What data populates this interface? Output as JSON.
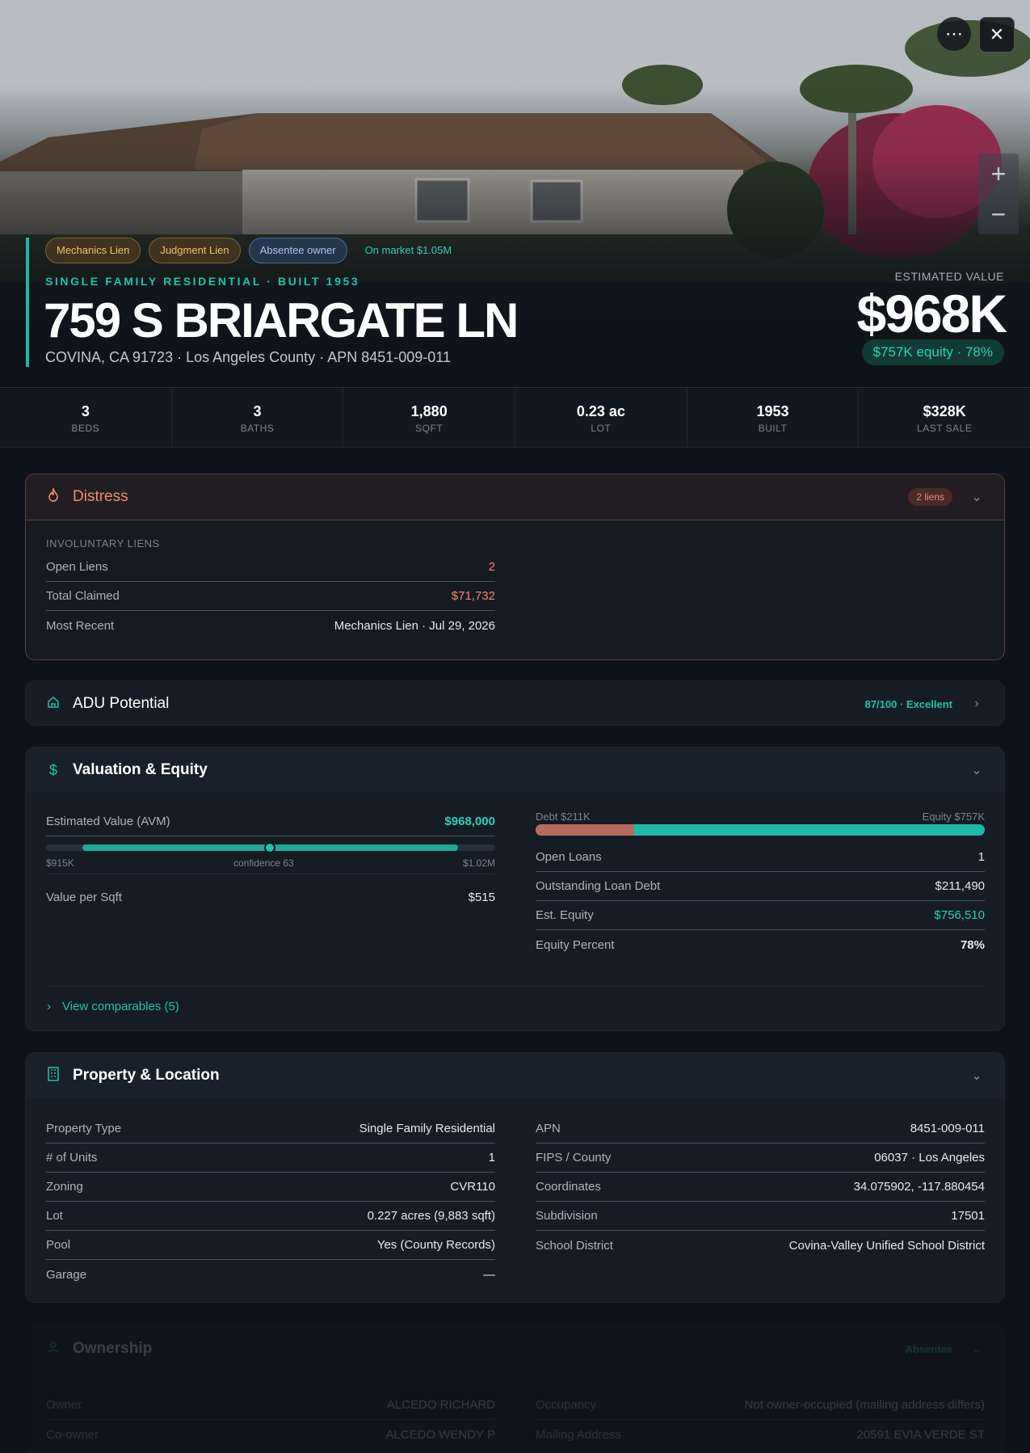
{
  "hero": {
    "tags": [
      "Mechanics Lien",
      "Judgment Lien",
      "Absentee owner",
      "On market $1.05M"
    ],
    "subtitle": "SINGLE FAMILY RESIDENTIAL · BUILT 1953",
    "address": "759 S BRIARGATE LN",
    "location": "COVINA, CA 91723 · Los Angeles County · APN 8451-009-011",
    "estimated_label": "ESTIMATED VALUE",
    "estimated_value": "$968K",
    "equity_badge": "$757K equity · 78%",
    "more_icon": "⋯",
    "close_icon": "✕",
    "zoom_in": "+",
    "zoom_out": "−"
  },
  "stats": [
    {
      "value": "3",
      "label": "BEDS"
    },
    {
      "value": "3",
      "label": "BATHS"
    },
    {
      "value": "1,880",
      "label": "SQFT"
    },
    {
      "value": "0.23 ac",
      "label": "LOT"
    },
    {
      "value": "1953",
      "label": "BUILT"
    },
    {
      "value": "$328K",
      "label": "LAST SALE"
    }
  ],
  "distress": {
    "title": "Distress",
    "badge": "2 liens",
    "section": "INVOLUNTARY LIENS",
    "rows": [
      {
        "k": "Open Liens",
        "v": "2"
      },
      {
        "k": "Total Claimed",
        "v": "$71,732"
      },
      {
        "k": "Most Recent",
        "v": "Mechanics Lien · Jul 29, 2026"
      }
    ]
  },
  "adu": {
    "title": "ADU Potential",
    "score": "87/100 · Excellent"
  },
  "valuation": {
    "title": "Valuation & Equity",
    "avm_label": "Estimated Value (AVM)",
    "avm_value": "$968,000",
    "range_low": "$915K",
    "confidence": "confidence 63",
    "range_high": "$1.02M",
    "vps_label": "Value per Sqft",
    "vps_value": "$515",
    "debt_label": "Debt $211K",
    "equity_label": "Equity $757K",
    "debt_fraction": 0.22,
    "rows": [
      {
        "k": "Open Loans",
        "v": "1"
      },
      {
        "k": "Outstanding Loan Debt",
        "v": "$211,490"
      },
      {
        "k": "Est. Equity",
        "v": "$756,510"
      },
      {
        "k": "Equity Percent",
        "v": "78%"
      }
    ],
    "comparables_link": "View comparables (5)"
  },
  "property": {
    "title": "Property & Location",
    "left": [
      {
        "k": "Property Type",
        "v": "Single Family Residential"
      },
      {
        "k": "# of Units",
        "v": "1"
      },
      {
        "k": "Zoning",
        "v": "CVR110"
      },
      {
        "k": "Lot",
        "v": "0.227 acres (9,883 sqft)"
      },
      {
        "k": "Pool",
        "v": "Yes (County Records)"
      },
      {
        "k": "Garage",
        "v": "—"
      }
    ],
    "right": [
      {
        "k": "APN",
        "v": "8451-009-011"
      },
      {
        "k": "FIPS / County",
        "v": "06037 · Los Angeles"
      },
      {
        "k": "Coordinates",
        "v": "34.075902, -117.880454"
      },
      {
        "k": "Subdivision",
        "v": "17501"
      },
      {
        "k": "School District",
        "v": "Covina-Valley Unified School District"
      }
    ]
  },
  "ownership": {
    "title": "Ownership",
    "badge": "Absentee",
    "left": [
      {
        "k": "Owner",
        "v": "ALCEDO RICHARD"
      },
      {
        "k": "Co-owner",
        "v": "ALCEDO WENDY P"
      }
    ],
    "right": [
      {
        "k": "Occupancy",
        "v": "Not owner-occupied (mailing address differs)"
      },
      {
        "k": "Mailing Address",
        "v": "20591 EVIA VERDE ST"
      }
    ]
  },
  "colors": {
    "accent": "#22c2a8",
    "distress": "#ef8a75",
    "debt": "#b86a5e",
    "background": "#0e131b"
  }
}
